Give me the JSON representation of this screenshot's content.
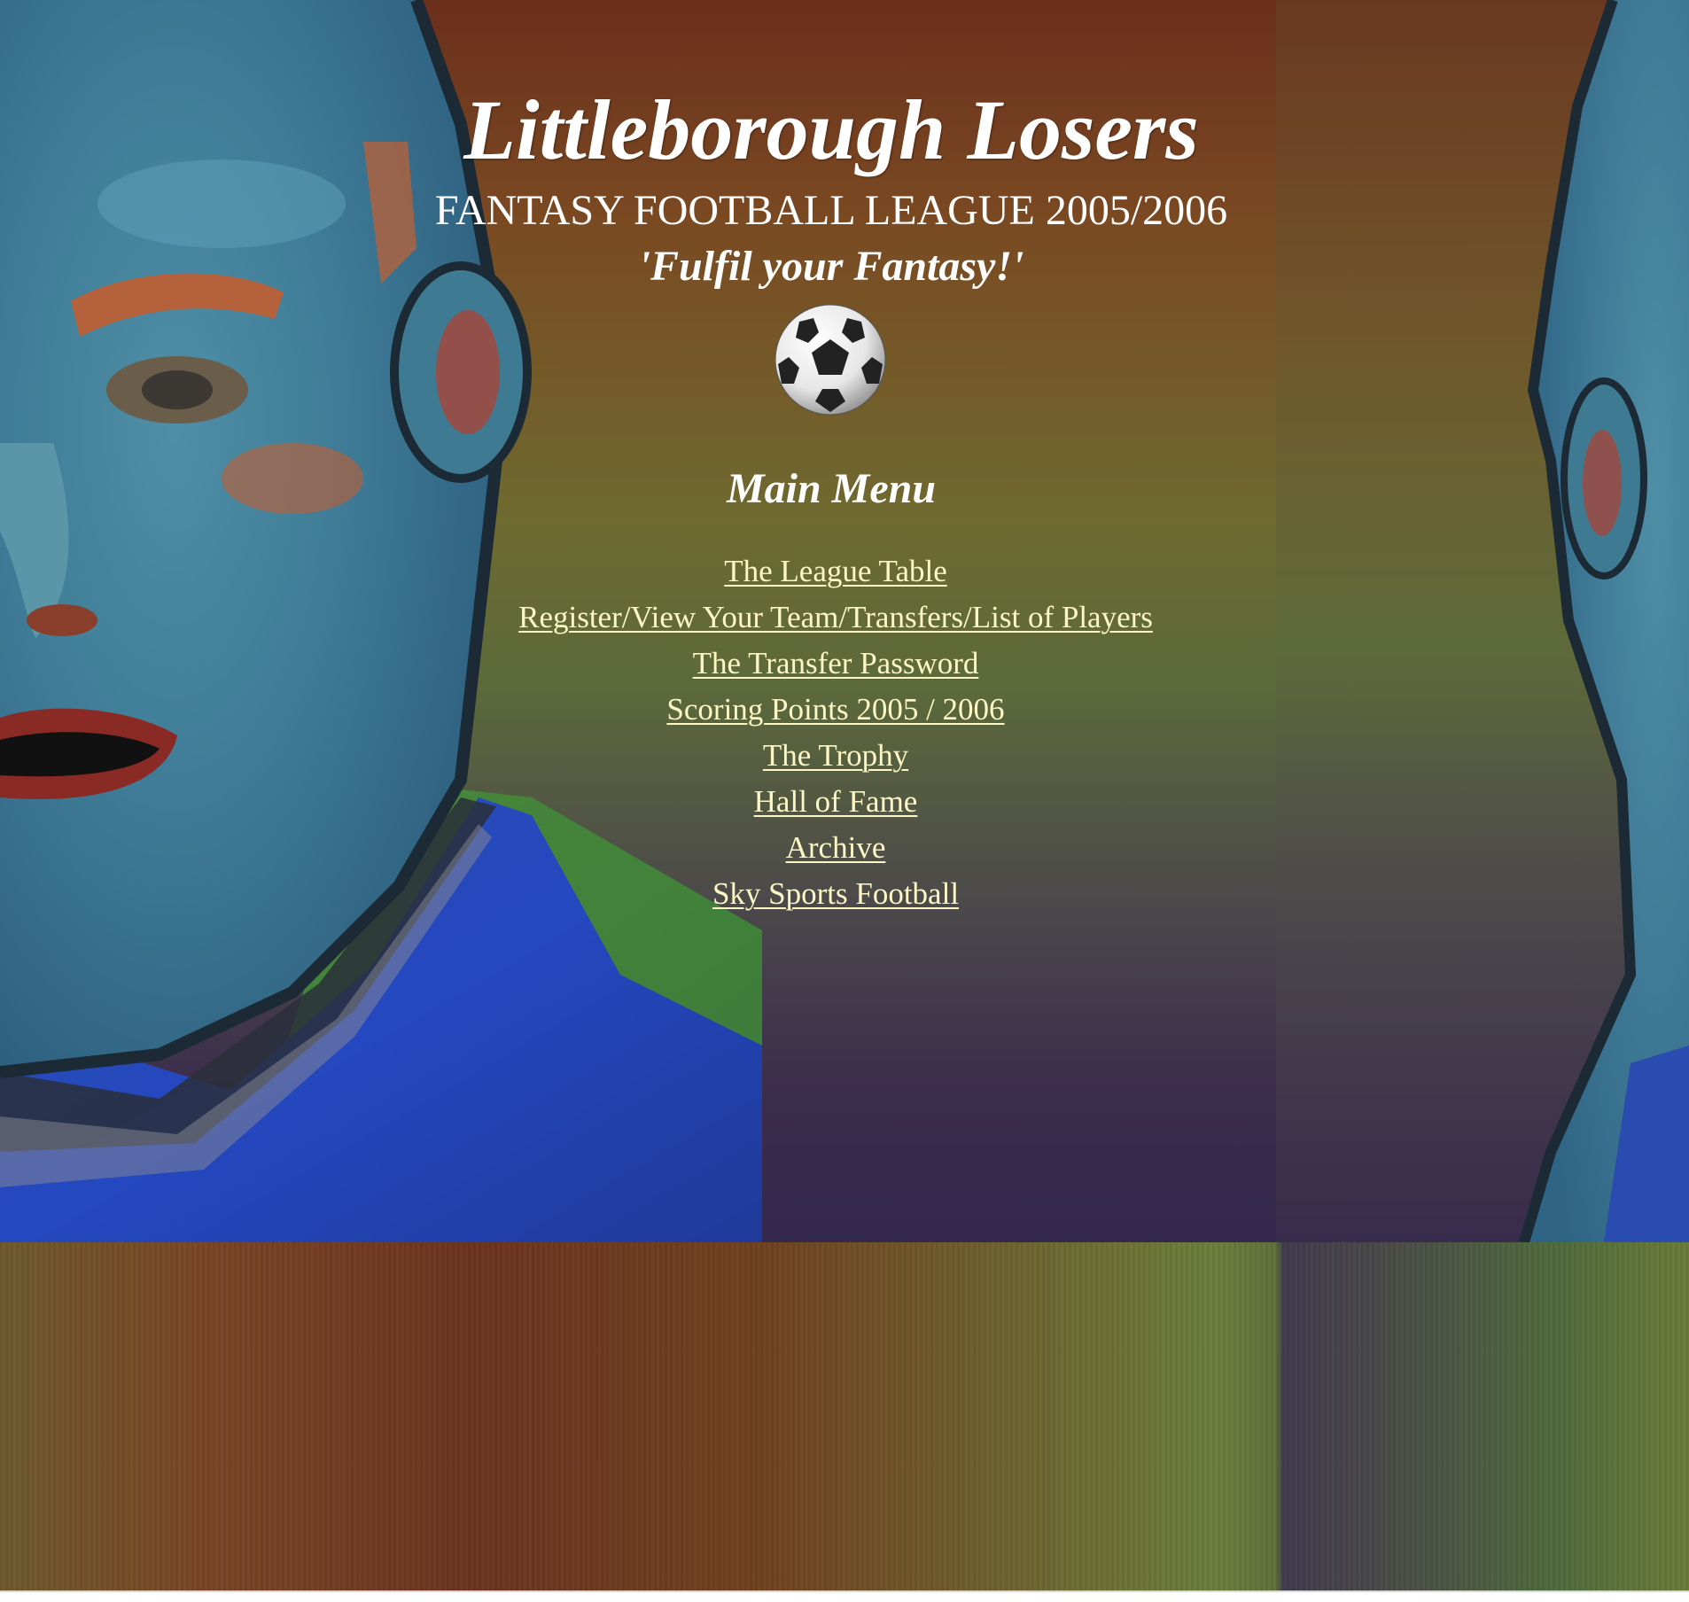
{
  "header": {
    "title": "Littleborough Losers",
    "subtitle": "FANTASY FOOTBALL LEAGUE 2005/2006",
    "tagline": "'Fulfil your Fantasy!'"
  },
  "menu": {
    "title": "Main Menu",
    "items": [
      {
        "label": "The League Table"
      },
      {
        "label": "Register/View Your Team/Transfers/List of Players"
      },
      {
        "label": "The Transfer Password"
      },
      {
        "label": "Scoring Points 2005 / 2006"
      },
      {
        "label": "The Trophy"
      },
      {
        "label": "Hall of Fame"
      },
      {
        "label": "Archive"
      },
      {
        "label": "Sky Sports Football"
      }
    ]
  },
  "colors": {
    "link": "#fcf7c4",
    "heading": "#ffffff",
    "bg_top": "#6b2f1c",
    "bg_mid": "#6e6a30",
    "bg_bottom": "#34284e"
  },
  "icons": {
    "ball": "football-icon"
  }
}
